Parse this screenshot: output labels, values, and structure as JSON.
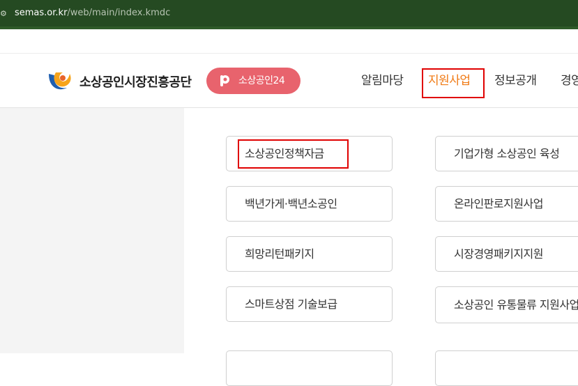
{
  "browser": {
    "url_host": "semas.or.kr",
    "url_path": "/web/main/index.kmdc",
    "site_icon": "settings-sliders-icon"
  },
  "header": {
    "logo_text": "소상공인시장진흥공단",
    "pill_label": "소상공인24",
    "nav": [
      "알림마당",
      "지원사업",
      "정보공개",
      "경영"
    ],
    "active_nav": "지원사업",
    "accent_color": "#f07a14",
    "pill_color": "#e8636d",
    "highlight_color": "#e00000"
  },
  "menu": {
    "left_column": [
      "소상공인정책자금",
      "백년가게·백년소공인",
      "희망리턴패키지",
      "스마트상점 기술보급"
    ],
    "right_column": [
      "기업가형 소상공인 육성",
      "온라인판로지원사업",
      "시장경영패키지지원",
      "소상공인 유통물류 지원사업"
    ],
    "highlighted_item": "소상공인정책자금"
  }
}
